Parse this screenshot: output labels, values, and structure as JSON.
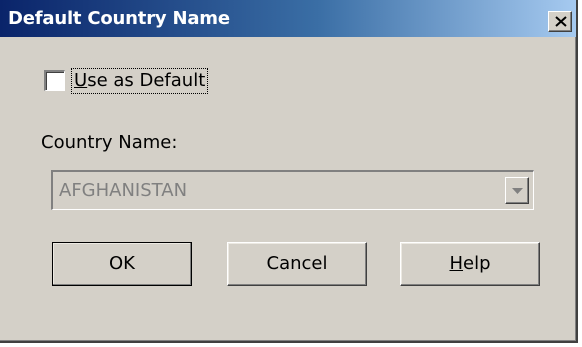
{
  "window": {
    "title": "Default Country Name",
    "close_glyph": "✕"
  },
  "checkbox": {
    "label": "Use as Default",
    "checked": false
  },
  "country": {
    "label": "Country Name:",
    "selected_value": "AFGHANISTAN",
    "enabled": false
  },
  "buttons": {
    "ok": "OK",
    "cancel": "Cancel",
    "help": "Help"
  },
  "colors": {
    "face": "#d4d0c8",
    "title_start": "#0a246a",
    "title_end": "#a6caf0",
    "disabled_text": "#808080"
  },
  "icons": {
    "close": "close-icon",
    "dropdown": "chevron-down-icon"
  }
}
